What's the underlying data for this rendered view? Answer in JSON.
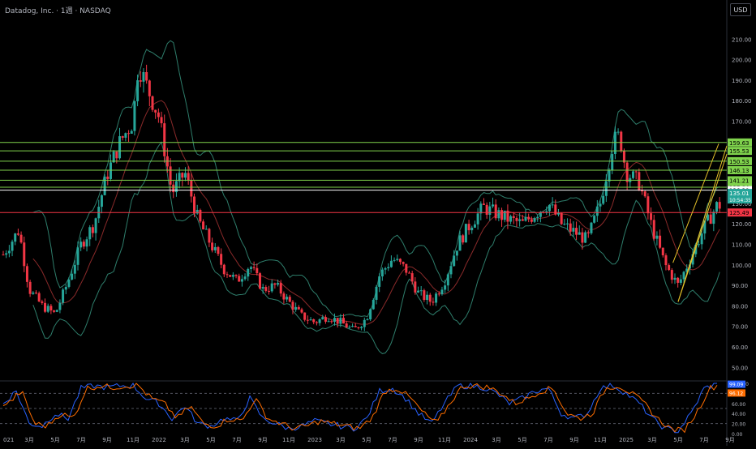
{
  "header": {
    "title": "Datadog, Inc. · 1週 · NASDAQ",
    "currency_button": "USD"
  },
  "chart_data": [
    {
      "type": "candlestick",
      "title": "Datadog, Inc. · 1週 · NASDAQ",
      "ylim": [
        45,
        218
      ],
      "yticks": [
        50,
        60,
        70,
        80,
        90,
        100,
        110,
        120,
        130,
        140,
        150,
        160,
        170,
        180,
        190,
        200,
        210
      ],
      "ytick_labels": [
        "50.00",
        "60.00",
        "70.00",
        "80.00",
        "90.00",
        "100.00",
        "110.00",
        "120.00",
        "130.00",
        "140.00",
        "150.00",
        "160.00",
        "170.00",
        "180.00",
        "190.00",
        "200.00",
        "210.00"
      ],
      "xtick_labels": [
        "021",
        "3月",
        "5月",
        "7月",
        "9月",
        "11月",
        "2022",
        "3月",
        "5月",
        "7月",
        "9月",
        "11月",
        "2023",
        "3月",
        "5月",
        "7月",
        "9月",
        "11月",
        "2024",
        "3月",
        "5月",
        "7月",
        "9月",
        "11月",
        "2025",
        "3月",
        "5月",
        "7月",
        "9月"
      ],
      "xtick_months": [
        0,
        2,
        4,
        6,
        8,
        10,
        12,
        14,
        16,
        18,
        20,
        22,
        24,
        26,
        28,
        30,
        32,
        34,
        36,
        38,
        40,
        42,
        44,
        46,
        48,
        50,
        52,
        54,
        56
      ],
      "x_start": "2020-12",
      "close_path": [
        [
          0,
          105
        ],
        [
          1.2,
          117
        ],
        [
          2,
          88
        ],
        [
          3,
          80
        ],
        [
          4,
          76
        ],
        [
          5,
          92
        ],
        [
          6,
          110
        ],
        [
          7,
          120
        ],
        [
          8,
          144
        ],
        [
          9,
          160
        ],
        [
          10,
          170
        ],
        [
          10.4,
          198
        ],
        [
          11,
          188
        ],
        [
          12,
          172
        ],
        [
          13,
          135
        ],
        [
          14,
          145
        ],
        [
          15,
          122
        ],
        [
          16,
          110
        ],
        [
          17,
          98
        ],
        [
          18,
          92
        ],
        [
          19,
          100
        ],
        [
          20,
          88
        ],
        [
          21,
          90
        ],
        [
          22,
          82
        ],
        [
          23,
          75
        ],
        [
          24,
          72
        ],
        [
          25,
          75
        ],
        [
          26,
          72
        ],
        [
          27,
          68
        ],
        [
          28,
          74
        ],
        [
          29,
          95
        ],
        [
          30,
          103
        ],
        [
          31,
          98
        ],
        [
          32,
          86
        ],
        [
          33,
          82
        ],
        [
          34,
          92
        ],
        [
          35,
          110
        ],
        [
          36,
          120
        ],
        [
          37,
          128
        ],
        [
          38,
          125
        ],
        [
          39,
          122
        ],
        [
          40,
          120
        ],
        [
          41,
          125
        ],
        [
          42,
          130
        ],
        [
          43,
          120
        ],
        [
          44,
          116
        ],
        [
          45,
          112
        ],
        [
          46,
          130
        ],
        [
          47,
          160
        ],
        [
          47.5,
          163
        ],
        [
          48,
          145
        ],
        [
          49,
          140
        ],
        [
          50,
          118
        ],
        [
          51,
          100
        ],
        [
          52,
          90
        ],
        [
          53,
          104
        ],
        [
          54,
          118
        ],
        [
          55,
          129
        ]
      ],
      "horizontal_levels": [
        {
          "value": 159.63,
          "label": "159.63",
          "color": "#7fd24c"
        },
        {
          "value": 155.53,
          "label": "155.53",
          "color": "#7fd24c"
        },
        {
          "value": 150.53,
          "label": "150.53",
          "color": "#7fd24c"
        },
        {
          "value": 146.13,
          "label": "146.13",
          "color": "#7fd24c"
        },
        {
          "value": 141.21,
          "label": "141.21",
          "color": "#7fd24c"
        },
        {
          "value": 137.84,
          "label": "137.84",
          "color": "#7fd24c"
        },
        {
          "value": 136.38,
          "label": "136.38",
          "color": "#ffffff"
        },
        {
          "value": 125.49,
          "label": "125.49",
          "color": "#f23645"
        }
      ],
      "last_price": {
        "value": 135.01,
        "label": "135.01",
        "countdown": "10:54:35",
        "color": "#26a69a"
      },
      "colors": {
        "up": "#26a69a",
        "down": "#f23645",
        "bollinger": "#2e7d6b",
        "basis": "#8a2a2a",
        "channel": "#e6c229"
      }
    },
    {
      "type": "line",
      "title": "",
      "ylim": [
        0,
        100
      ],
      "yticks": [
        0,
        20,
        40,
        60,
        80,
        100
      ],
      "ytick_labels": [
        "0.00",
        "20.00",
        "40.00",
        "60.00",
        "80.00",
        "100.00"
      ],
      "guide_levels": [
        20,
        50,
        80
      ],
      "series": [
        {
          "color": "#2962ff",
          "last": 99.09,
          "last_label": "99.09"
        },
        {
          "color": "#ff6d00",
          "last": 96.12,
          "last_label": "96.12"
        }
      ],
      "path": [
        [
          0,
          60
        ],
        [
          1,
          85
        ],
        [
          2,
          20
        ],
        [
          3,
          15
        ],
        [
          4,
          40
        ],
        [
          5,
          30
        ],
        [
          6,
          90
        ],
        [
          7,
          95
        ],
        [
          8,
          92
        ],
        [
          9,
          95
        ],
        [
          10,
          96
        ],
        [
          11,
          70
        ],
        [
          12,
          60
        ],
        [
          13,
          30
        ],
        [
          14,
          55
        ],
        [
          15,
          20
        ],
        [
          16,
          15
        ],
        [
          17,
          30
        ],
        [
          18,
          25
        ],
        [
          19,
          70
        ],
        [
          20,
          30
        ],
        [
          21,
          20
        ],
        [
          22,
          10
        ],
        [
          23,
          15
        ],
        [
          24,
          25
        ],
        [
          25,
          20
        ],
        [
          26,
          15
        ],
        [
          27,
          10
        ],
        [
          28,
          30
        ],
        [
          29,
          85
        ],
        [
          30,
          90
        ],
        [
          31,
          70
        ],
        [
          32,
          40
        ],
        [
          33,
          20
        ],
        [
          34,
          60
        ],
        [
          35,
          95
        ],
        [
          36,
          95
        ],
        [
          37,
          92
        ],
        [
          38,
          80
        ],
        [
          39,
          60
        ],
        [
          40,
          70
        ],
        [
          41,
          85
        ],
        [
          42,
          90
        ],
        [
          43,
          40
        ],
        [
          44,
          30
        ],
        [
          45,
          40
        ],
        [
          46,
          90
        ],
        [
          47,
          96
        ],
        [
          48,
          80
        ],
        [
          49,
          60
        ],
        [
          50,
          30
        ],
        [
          51,
          10
        ],
        [
          52,
          5
        ],
        [
          53,
          40
        ],
        [
          54,
          90
        ],
        [
          55,
          99
        ]
      ]
    }
  ]
}
